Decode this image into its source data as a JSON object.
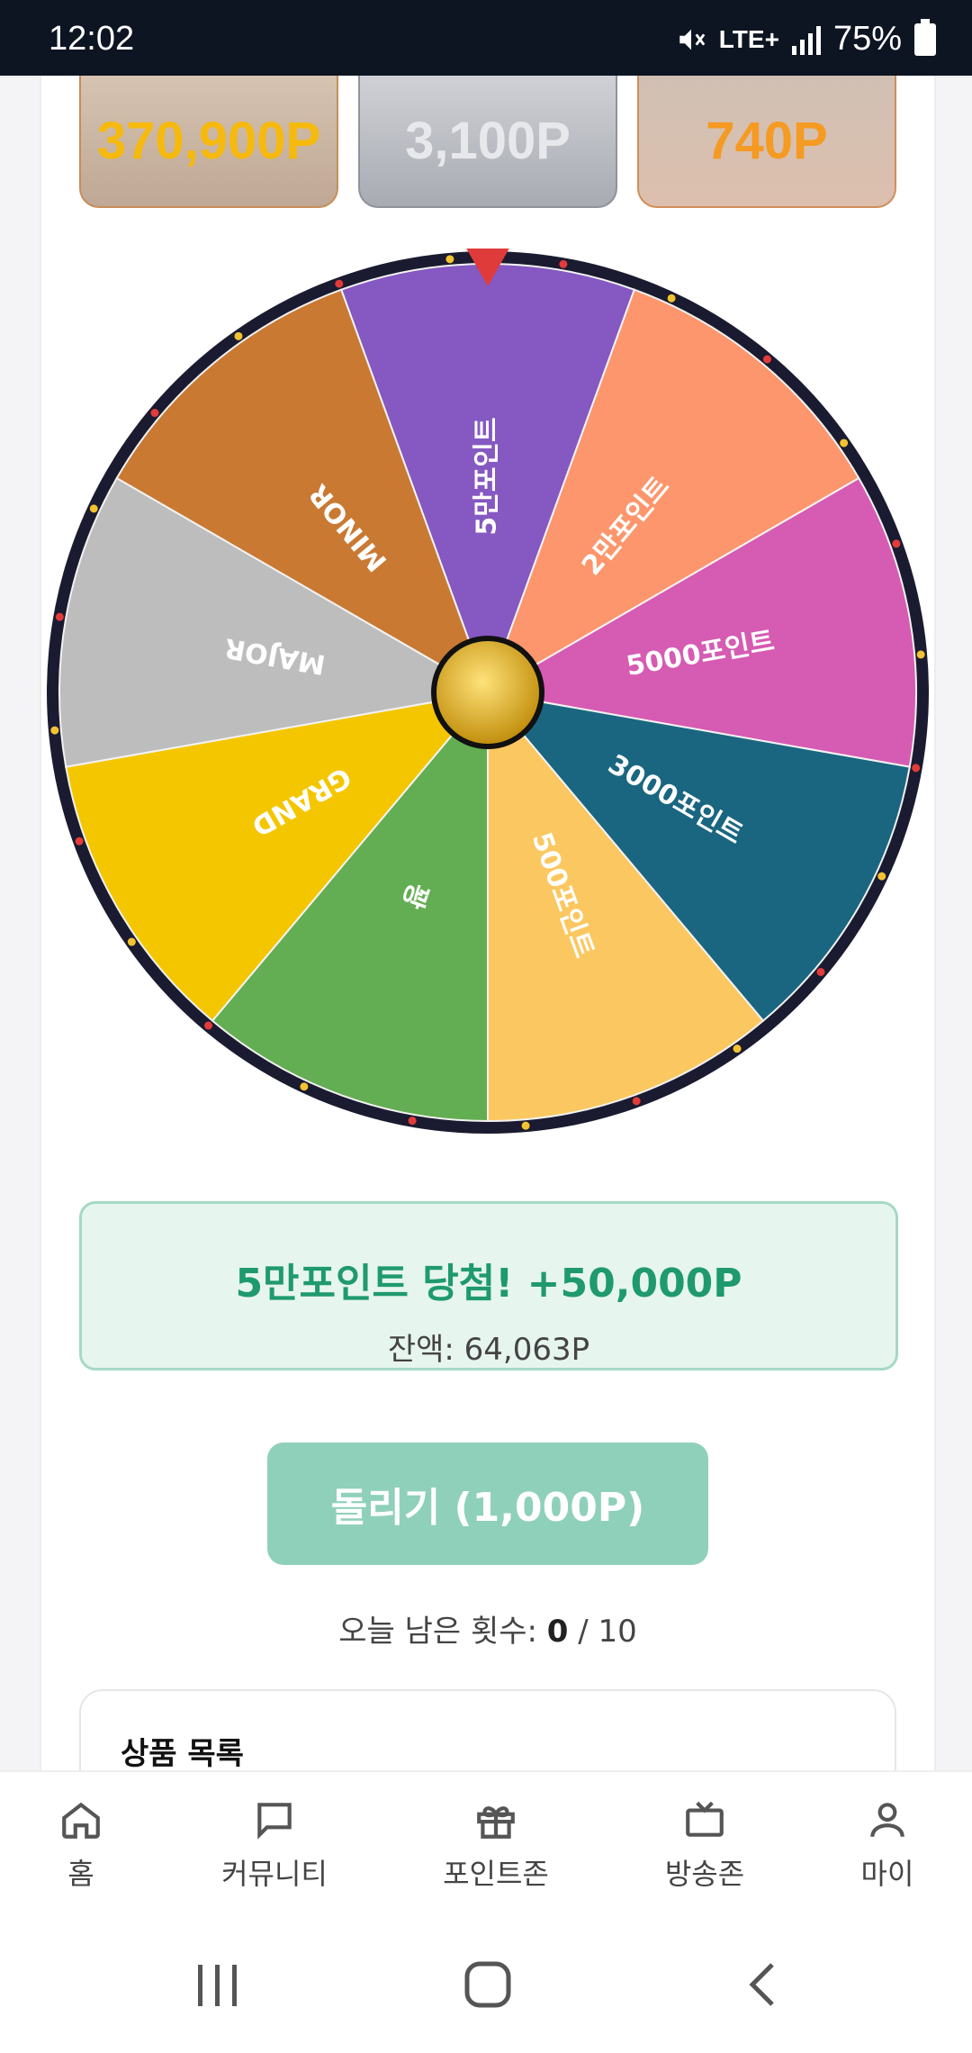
{
  "status": {
    "time": "12:02",
    "network": "LTE+",
    "battery": "75%"
  },
  "jackpots": [
    "370,900P",
    "3,100P",
    "740P"
  ],
  "wheel": {
    "segments": [
      {
        "label": "5만포인트",
        "color": "#8558c2"
      },
      {
        "label": "2만포인트",
        "color": "#fd966c"
      },
      {
        "label": "5000포인트",
        "color": "#d65bb2"
      },
      {
        "label": "3000포인트",
        "color": "#1a6680"
      },
      {
        "label": "500포인트",
        "color": "#fbc760"
      },
      {
        "label": "꽝",
        "color": "#63ad52"
      },
      {
        "label": "GRAND",
        "color": "#f4c600"
      },
      {
        "label": "MAJOR",
        "color": "#bdbdbd"
      },
      {
        "label": "MINOR",
        "color": "#c97932"
      }
    ],
    "rim_color": "#1a1b30",
    "pointer_color": "#e03b3b"
  },
  "result": {
    "title": "5만포인트 당첨! +50,000P",
    "balance": "잔액: 64,063P"
  },
  "spin_button": "돌리기 (1,000P)",
  "remaining": {
    "label": "오늘 남은 횟수:",
    "count": "0",
    "total": "/ 10"
  },
  "products": {
    "title": "상품 목록"
  },
  "nav": [
    {
      "label": "홈",
      "icon": "home-icon"
    },
    {
      "label": "커뮤니티",
      "icon": "chat-icon"
    },
    {
      "label": "포인트존",
      "icon": "gift-icon"
    },
    {
      "label": "방송존",
      "icon": "tv-icon"
    },
    {
      "label": "마이",
      "icon": "user-icon"
    }
  ]
}
